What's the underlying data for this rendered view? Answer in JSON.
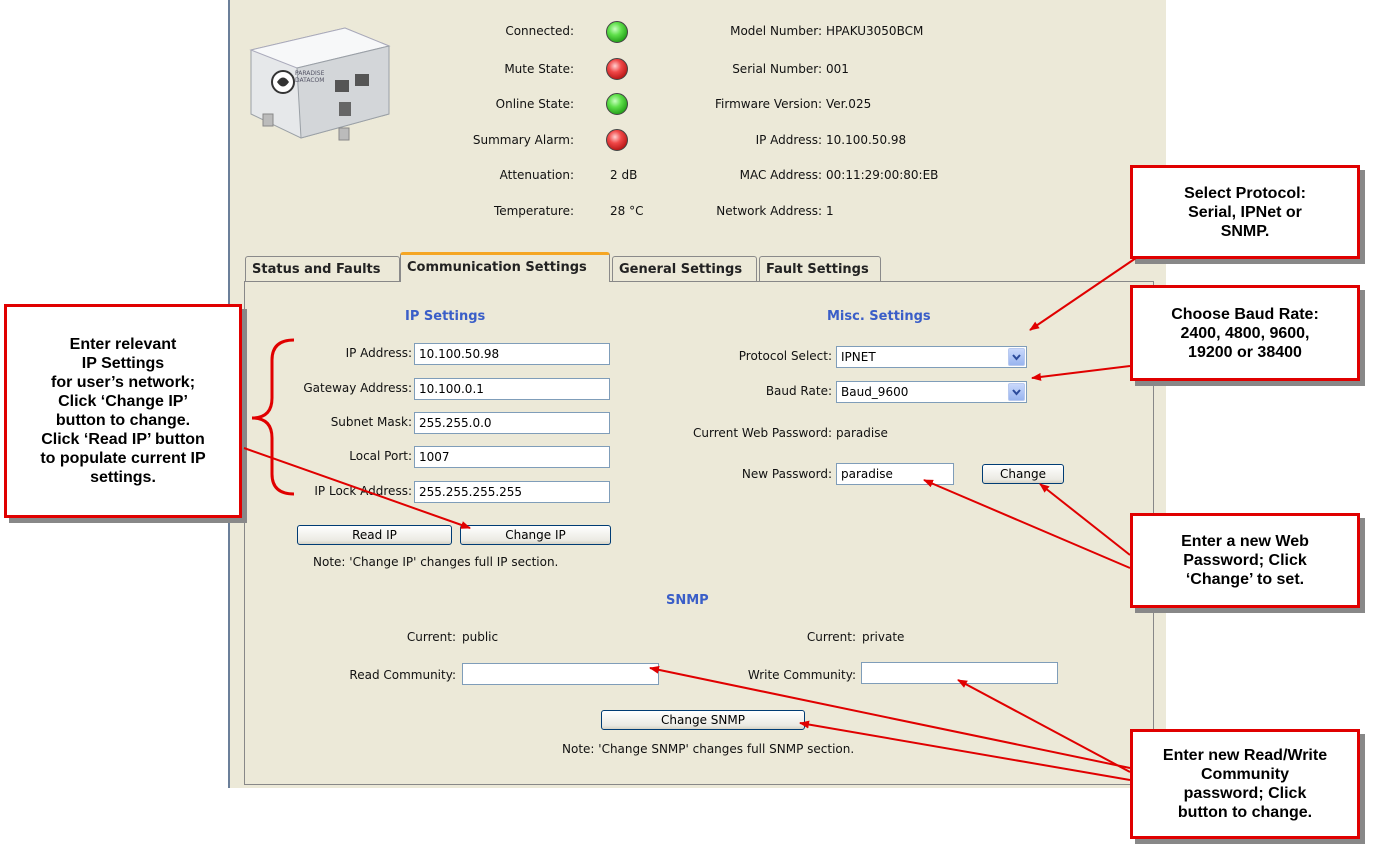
{
  "device": {
    "status_labels": [
      "Connected:",
      "Mute State:",
      "Online State:",
      "Summary Alarm:",
      "Attenuation:",
      "Temperature:"
    ],
    "leds": [
      "green",
      "red",
      "green",
      "red"
    ],
    "attenuation": "2 dB",
    "temperature": "28 °C",
    "info_labels": [
      "Model Number:",
      "Serial Number:",
      "Firmware Version:",
      "IP Address:",
      "MAC Address:",
      "Network Address:"
    ],
    "info_values": [
      "HPAKU3050BCM",
      "001",
      "Ver.025",
      "10.100.50.98",
      "00:11:29:00:80:EB",
      "1"
    ],
    "logo_text": "PARADISE DATACOM"
  },
  "tabs": [
    "Status and Faults",
    "Communication Settings",
    "General Settings",
    "Fault Settings"
  ],
  "active_tab": 1,
  "ip_settings": {
    "title": "IP Settings",
    "labels": [
      "IP Address:",
      "Gateway Address:",
      "Subnet Mask:",
      "Local Port:",
      "IP Lock Address:"
    ],
    "values": [
      "10.100.50.98",
      "10.100.0.1",
      "255.255.0.0",
      "1007",
      "255.255.255.255"
    ],
    "read_button": "Read IP",
    "change_button": "Change IP",
    "note": "Note: 'Change IP' changes full IP section."
  },
  "misc_settings": {
    "title": "Misc. Settings",
    "protocol_label": "Protocol Select:",
    "protocol_value": "IPNET",
    "baud_label": "Baud Rate:",
    "baud_value": "Baud_9600",
    "current_pw_label": "Current Web Password:",
    "current_pw_value": "paradise",
    "new_pw_label": "New Password:",
    "new_pw_value": "paradise",
    "change_button": "Change"
  },
  "snmp": {
    "title": "SNMP",
    "current_label": "Current:",
    "read_current": "public",
    "write_current": "private",
    "read_label": "Read Community:",
    "write_label": "Write Community:",
    "read_value": "",
    "write_value": "",
    "change_button": "Change SNMP",
    "note": "Note: 'Change SNMP' changes full SNMP section."
  },
  "callouts": {
    "ip": [
      "Enter relevant",
      "IP Settings",
      "for user’s network;",
      "Click ‘Change IP’",
      "button to change.",
      "Click ‘Read IP’ button",
      "to populate current IP",
      "settings."
    ],
    "protocol": [
      "Select Protocol:",
      "Serial, IPNet or",
      "SNMP."
    ],
    "baud": [
      "Choose Baud Rate:",
      "2400, 4800, 9600,",
      "19200 or 38400"
    ],
    "password": [
      "Enter a new Web",
      "Password; Click",
      "‘Change’ to set."
    ],
    "snmp": [
      "Enter new Read/Write",
      "Community",
      "password; Click",
      "button to change."
    ]
  },
  "colors": {
    "callout_border": "#e00000",
    "arrow": "#e00000",
    "section_title": "#3a5ec8",
    "window_bg": "#ece9d8",
    "active_tab_accent": "#f5a623"
  }
}
